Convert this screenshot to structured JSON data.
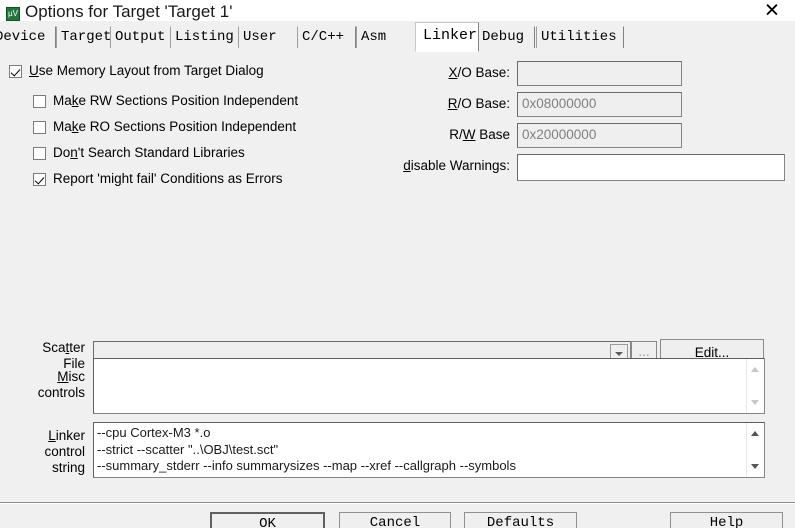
{
  "window": {
    "title": "Options for Target 'Target 1'",
    "icon": "uvision-logo-icon",
    "close_label": "✕"
  },
  "tabs": [
    {
      "label": "Device",
      "selected": false
    },
    {
      "label": "Target",
      "selected": false
    },
    {
      "label": "Output",
      "selected": false
    },
    {
      "label": "Listing",
      "selected": false
    },
    {
      "label": "User",
      "selected": false
    },
    {
      "label": "C/C++",
      "selected": false
    },
    {
      "label": "Asm",
      "selected": false
    },
    {
      "label": "Linker",
      "selected": true
    },
    {
      "label": "Debug",
      "selected": false
    },
    {
      "label": "Utilities",
      "selected": false
    }
  ],
  "linker": {
    "checkboxes": [
      {
        "name": "use-memory-layout",
        "pre": "",
        "accel": "U",
        "post": "se Memory Layout from Target Dialog",
        "checked": true
      },
      {
        "name": "make-rw-position-independent",
        "pre": "Ma",
        "accel": "k",
        "post": "e RW Sections Position Independent",
        "checked": false
      },
      {
        "name": "make-ro-position-independent",
        "pre": "Ma",
        "accel": "k",
        "post": "e RO Sections Position Independent",
        "checked": false
      },
      {
        "name": "dont-search-standard-libraries",
        "pre": "Do",
        "accel": "n",
        "post": "'t Search Standard Libraries",
        "checked": false
      },
      {
        "name": "report-might-fail-as-errors",
        "pre": "Report 'mi",
        "accel": "g",
        "post": "ht fail' Conditions as Errors",
        "checked": true
      }
    ],
    "fields": [
      {
        "name": "xo-base",
        "pre": "",
        "accel": "X",
        "post": "/O Base:",
        "value": "",
        "disabled": true
      },
      {
        "name": "ro-base",
        "pre": "",
        "accel": "R",
        "post": "/O Base:",
        "value": "0x08000000",
        "disabled": true
      },
      {
        "name": "rw-base",
        "pre": "R/",
        "accel": "W",
        "post": " Base",
        "value": "0x20000000",
        "disabled": true
      },
      {
        "name": "disable-warnings",
        "pre": "",
        "accel": "d",
        "post": "isable Warnings:",
        "value": "",
        "disabled": false
      }
    ],
    "scatter": {
      "label_line1": "Scatter",
      "label_line2": "File",
      "label_accel": "t",
      "value": "",
      "browse_label": "...",
      "browse_disabled": true,
      "edit_label": "Edit...",
      "dropdown_icon": "chevron-down-icon"
    },
    "misc": {
      "label_line1": "Misc",
      "label_line2": "controls",
      "label_accel": "M",
      "value": ""
    },
    "control_string": {
      "label_line1": "Linker",
      "label_line2": "control",
      "label_line3": "string",
      "label_accel": "L",
      "value": "--cpu Cortex-M3 *.o\n--strict --scatter \"..\\OBJ\\test.sct\"\n--summary_stderr --info summarysizes --map --xref --callgraph --symbols"
    }
  },
  "buttons": [
    {
      "name": "ok-button",
      "label": "OK",
      "default": true
    },
    {
      "name": "cancel-button",
      "label": "Cancel",
      "default": false
    },
    {
      "name": "defaults-button",
      "label": "Defaults",
      "default": false
    },
    {
      "name": "help-button",
      "label": "Help",
      "default": false
    }
  ]
}
